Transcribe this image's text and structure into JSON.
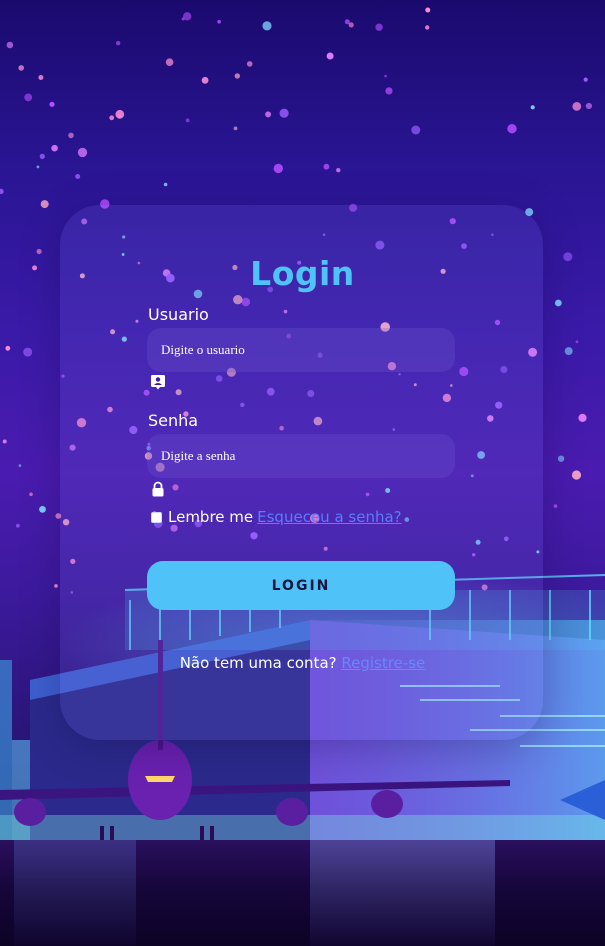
{
  "login": {
    "title": "Login",
    "username_label": "Usuario",
    "username_placeholder": "Digite o usuario",
    "password_label": "Senha",
    "password_placeholder": "Digite a senha",
    "remember_label": "Lembre me",
    "forgot_link": "Esqueceu a senha?",
    "submit_label": "LOGIN",
    "register_prompt": "Não tem uma conta?",
    "register_link": "Registre-se"
  },
  "icons": {
    "username": "user-badge-icon",
    "password": "lock-icon"
  },
  "colors": {
    "accent": "#4fc3f7",
    "link": "#5b7cff",
    "background_top": "#1a0a6e",
    "background_mid": "#4a1bb0"
  }
}
